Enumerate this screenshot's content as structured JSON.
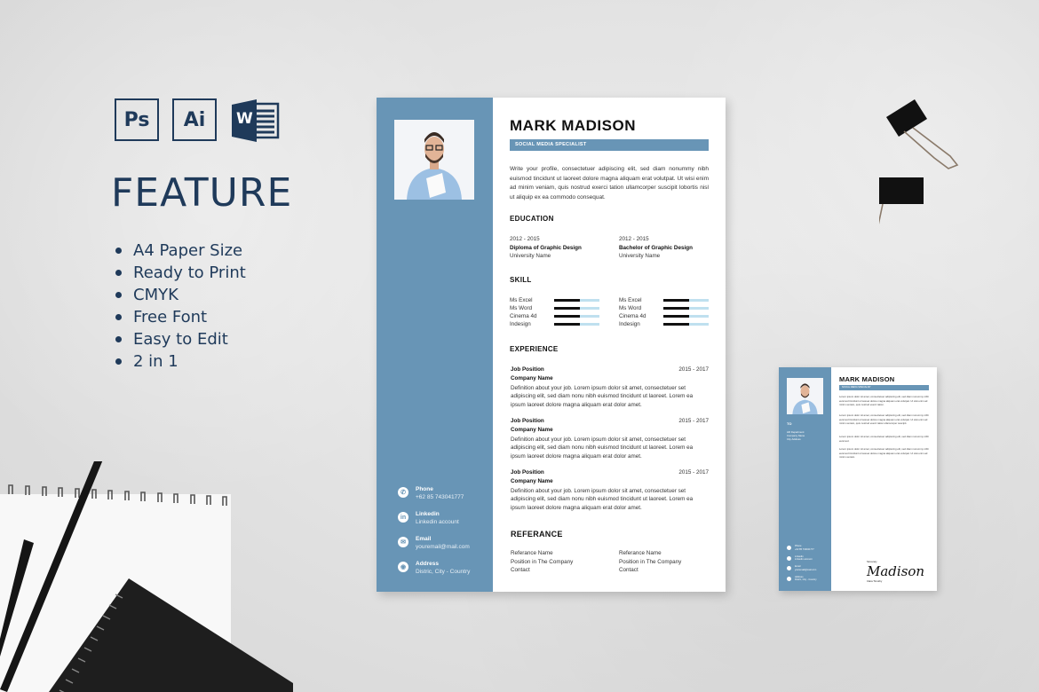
{
  "app_icons": [
    {
      "name": "photoshop",
      "label": "Ps"
    },
    {
      "name": "illustrator",
      "label": "Ai"
    },
    {
      "name": "word",
      "label": "W"
    }
  ],
  "feature": {
    "title": "FEATURE",
    "items": [
      "A4 Paper Size",
      "Ready to Print",
      "CMYK",
      "Free Font",
      "Easy to Edit",
      "2 in 1"
    ]
  },
  "colors": {
    "navy": "#1f3a5a",
    "accent_blue": "#6895b6",
    "skill_bar_bg": "#bfe0ef"
  },
  "resume": {
    "name": "MARK MADISON",
    "role": "SOCIAL MEDIA SPECIALIST",
    "profile": "Write your profile, consectetuer adipiscing elit, sed diam nonummy nibh euismod tincidunt ut laoreet dolore magna aliquam erat volutpat. Ut wisi enim ad minim veniam, quis nostrud exerci tation ullamcorper suscipit lobortis nisl ut aliquip ex ea commodo consequat.",
    "education_heading": "EDUCATION",
    "education": [
      {
        "years": "2012 - 2015",
        "degree": "Diploma of Graphic Design",
        "school": "University Name"
      },
      {
        "years": "2012 - 2015",
        "degree": "Bachelor of Graphic Design",
        "school": "University Name"
      }
    ],
    "skill_heading": "SKILL",
    "skills": [
      [
        {
          "name": "Ms Excel",
          "level": 0.57
        },
        {
          "name": "Ms Word",
          "level": 0.57
        },
        {
          "name": "Cinema 4d",
          "level": 0.57
        },
        {
          "name": "Indesign",
          "level": 0.57
        }
      ],
      [
        {
          "name": "Ms Excel",
          "level": 0.57
        },
        {
          "name": "Ms Word",
          "level": 0.57
        },
        {
          "name": "Cinema 4d",
          "level": 0.57
        },
        {
          "name": "Indesign",
          "level": 0.57
        }
      ]
    ],
    "experience_heading": "EXPERIENCE",
    "experience": [
      {
        "position": "Job Position",
        "years": "2015 - 2017",
        "company": "Company Name",
        "desc": "Definition about your job. Lorem ipsum dolor sit amet, consectetuer set adipiscing elit, sed diam nonu nibh euismod tincidunt ut laoreet. Lorem ea ipsum laoreet dolore magna aliquam erat dolor amet."
      },
      {
        "position": "Job Position",
        "years": "2015 - 2017",
        "company": "Company Name",
        "desc": "Definition about your job. Lorem ipsum dolor sit amet, consectetuer set adipiscing elit, sed diam nonu nibh euismod tincidunt ut laoreet. Lorem ea ipsum laoreet dolore magna aliquam erat dolor amet."
      },
      {
        "position": "Job Position",
        "years": "2015 - 2017",
        "company": "Company Name",
        "desc": "Definition about your job. Lorem ipsum dolor sit amet, consectetuer set adipiscing elit, sed diam nonu nibh euismod tincidunt ut laoreet. Lorem ea ipsum laoreet dolore magna aliquam erat dolor amet."
      }
    ],
    "reference_heading": "REFERANCE",
    "references": [
      {
        "name": "Referance Name",
        "position": "Position in The Company",
        "contact": "Contact"
      },
      {
        "name": "Referance Name",
        "position": "Position in The Company",
        "contact": "Contact"
      }
    ],
    "contact": [
      {
        "icon": "phone-icon",
        "glyph": "✆",
        "label": "Phone",
        "value": "+62 85 743041777"
      },
      {
        "icon": "linkedin-icon",
        "glyph": "in",
        "label": "Linkedin",
        "value": "Linkedin account"
      },
      {
        "icon": "email-icon",
        "glyph": "✉",
        "label": "Email",
        "value": "youremail@mail.com"
      },
      {
        "icon": "location-icon",
        "glyph": "◉",
        "label": "Address",
        "value": "Distric, City - Country"
      }
    ]
  },
  "cover_letter": {
    "name": "MARK MADISON",
    "role": "SOCIAL MEDIA SPECIALIST",
    "to_label": "TO",
    "to_lines": [
      "HR Department",
      "Company Name",
      "City Address"
    ],
    "paragraphs": [
      "Lorem ipsum dolor sit amet, consectetuer adipiscing elit, sed diam nonummy nibh euismod tincidunt ut laoreet dolore magna aliquam erat volutpat. Ut wisi enim ad minim veniam, quis nostrud exerci tation.",
      "Lorem ipsum dolor sit amet, consectetuer adipiscing elit, sed diam nonummy nibh euismod tincidunt ut laoreet dolore magna aliquam erat volutpat. Ut wisi enim ad minim veniam, quis nostrud exerci tation ullamcorper suscipit.",
      "Lorem ipsum dolor sit amet, consectetuer adipiscing elit, sed diam nonummy nibh euismod.",
      "Lorem ipsum dolor sit amet, consectetuer adipiscing elit, sed diam nonummy nibh euismod tincidunt ut laoreet dolore magna aliquam erat volutpat. Ut wisi enim ad minim veniam."
    ],
    "contact": [
      {
        "label": "Phone",
        "value": "+62 85 743041777"
      },
      {
        "label": "Linkedin",
        "value": "Linkedin account"
      },
      {
        "label": "Email",
        "value": "youremail@mail.com"
      },
      {
        "label": "Address",
        "value": "Distric, City - Country"
      }
    ],
    "sign_prefix": "Sincerely",
    "signature": "Madison",
    "sign_name": "Clara Timothy"
  }
}
